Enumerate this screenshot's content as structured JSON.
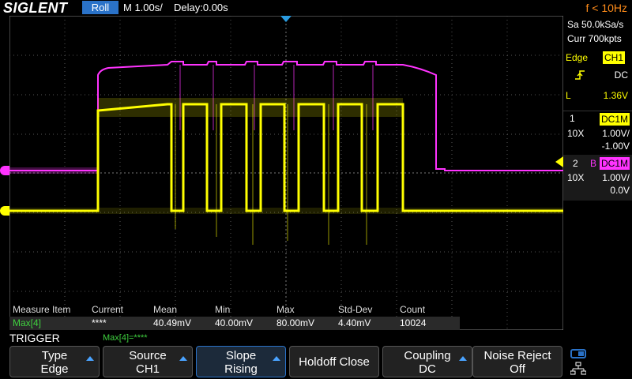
{
  "topbar": {
    "logo": "SIGLENT",
    "mode": "Roll",
    "timebase": "M 1.00s/",
    "delay": "Delay:0.00s",
    "freq": "f < 10Hz"
  },
  "acquire": {
    "sample_rate": "Sa 50.0kSa/s",
    "memory": "Curr 700kpts"
  },
  "trigger_info": {
    "type": "Edge",
    "source": "CH1",
    "coupling": "DC",
    "level_label": "L",
    "level": "1.36V"
  },
  "channels": [
    {
      "num": "1",
      "tag": "DC1M",
      "probe": "10X",
      "scale": "1.00V/",
      "offset": "-1.00V",
      "color": "#ffff00"
    },
    {
      "num": "2",
      "bw": "B",
      "tag": "DC1M",
      "probe": "10X",
      "scale": "1.00V/",
      "offset": "0.0V",
      "color": "#ff33ff"
    }
  ],
  "measure": {
    "headers": [
      "Measure Item",
      "Current",
      "Mean",
      "Min",
      "Max",
      "Std-Dev",
      "Count"
    ],
    "row": [
      "Max[4]",
      "****",
      "40.49mV",
      "40.00mV",
      "80.00mV",
      "4.40mV",
      "10024"
    ]
  },
  "menu": {
    "title": "TRIGGER",
    "status": "Max[4]=****",
    "buttons": [
      {
        "l1": "Type",
        "l2": "Edge"
      },
      {
        "l1": "Source",
        "l2": "CH1"
      },
      {
        "l1": "Slope",
        "l2": "Rising"
      },
      {
        "single": "Holdoff Close"
      },
      {
        "l1": "Coupling",
        "l2": "DC"
      },
      {
        "l1": "Noise Reject",
        "l2": "Off"
      }
    ]
  },
  "colors": {
    "ch1": "#ffff00",
    "ch2": "#ff33ff",
    "accent": "#2a72c8",
    "freq": "#ff8c1a"
  }
}
